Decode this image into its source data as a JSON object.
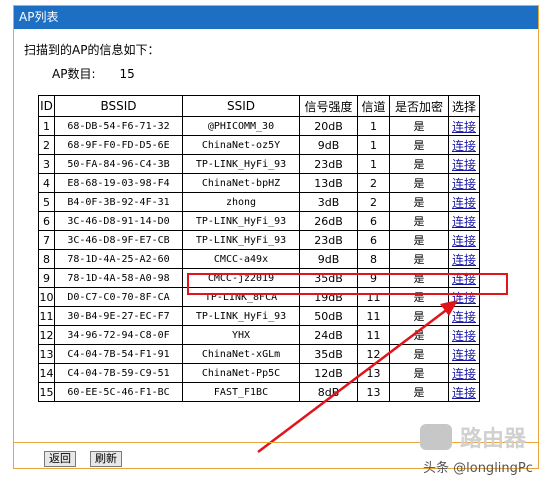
{
  "panel": {
    "title": "AP列表"
  },
  "scan_title": "扫描到的AP的信息如下：",
  "ap_count": {
    "label": "AP数目:",
    "value": "15"
  },
  "table": {
    "headers": [
      "ID",
      "BSSID",
      "SSID",
      "信号强度",
      "信道",
      "是否加密",
      "选择"
    ],
    "rows": [
      [
        "1",
        "68-DB-54-F6-71-32",
        "@PHICOMM_30",
        "20dB",
        "1",
        "是",
        "连接"
      ],
      [
        "2",
        "68-9F-F0-FD-D5-6E",
        "ChinaNet-oz5Y",
        "9dB",
        "1",
        "是",
        "连接"
      ],
      [
        "3",
        "50-FA-84-96-C4-3B",
        "TP-LINK_HyFi_93",
        "23dB",
        "1",
        "是",
        "连接"
      ],
      [
        "4",
        "E8-68-19-03-98-F4",
        "ChinaNet-bpHZ",
        "13dB",
        "2",
        "是",
        "连接"
      ],
      [
        "5",
        "B4-0F-3B-92-4F-31",
        "zhong",
        "3dB",
        "2",
        "是",
        "连接"
      ],
      [
        "6",
        "3C-46-D8-91-14-D0",
        "TP-LINK_HyFi_93",
        "26dB",
        "6",
        "是",
        "连接"
      ],
      [
        "7",
        "3C-46-D8-9F-E7-CB",
        "TP-LINK_HyFi_93",
        "23dB",
        "6",
        "是",
        "连接"
      ],
      [
        "8",
        "78-1D-4A-25-A2-60",
        "CMCC-a49x",
        "9dB",
        "8",
        "是",
        "连接"
      ],
      [
        "9",
        "78-1D-4A-58-A0-98",
        "CMCC-jz2019",
        "35dB",
        "9",
        "是",
        "连接"
      ],
      [
        "10",
        "D0-C7-C0-70-8F-CA",
        "TP-LINK_8FCA",
        "19dB",
        "11",
        "是",
        "连接"
      ],
      [
        "11",
        "30-B4-9E-27-EC-F7",
        "TP-LINK_HyFi_93",
        "50dB",
        "11",
        "是",
        "连接"
      ],
      [
        "12",
        "34-96-72-94-C8-0F",
        "YHX",
        "24dB",
        "11",
        "是",
        "连接"
      ],
      [
        "13",
        "C4-04-7B-54-F1-91",
        "ChinaNet-xGLm",
        "35dB",
        "12",
        "是",
        "连接"
      ],
      [
        "14",
        "C4-04-7B-59-C9-51",
        "ChinaNet-Pp5C",
        "12dB",
        "13",
        "是",
        "连接"
      ],
      [
        "15",
        "60-EE-5C-46-F1-BC",
        "FAST_F1BC",
        "8dB",
        "13",
        "是",
        "连接"
      ]
    ]
  },
  "buttons": {
    "back": "返回",
    "refresh": "刷新"
  },
  "watermark": {
    "logo_text": "路由器",
    "caption": "头条 @longlingPc"
  },
  "colors": {
    "title_bar": "#1c6fc3",
    "border": "#e8a73c",
    "highlight": "#e0141a",
    "link": "#1a1aa6"
  }
}
